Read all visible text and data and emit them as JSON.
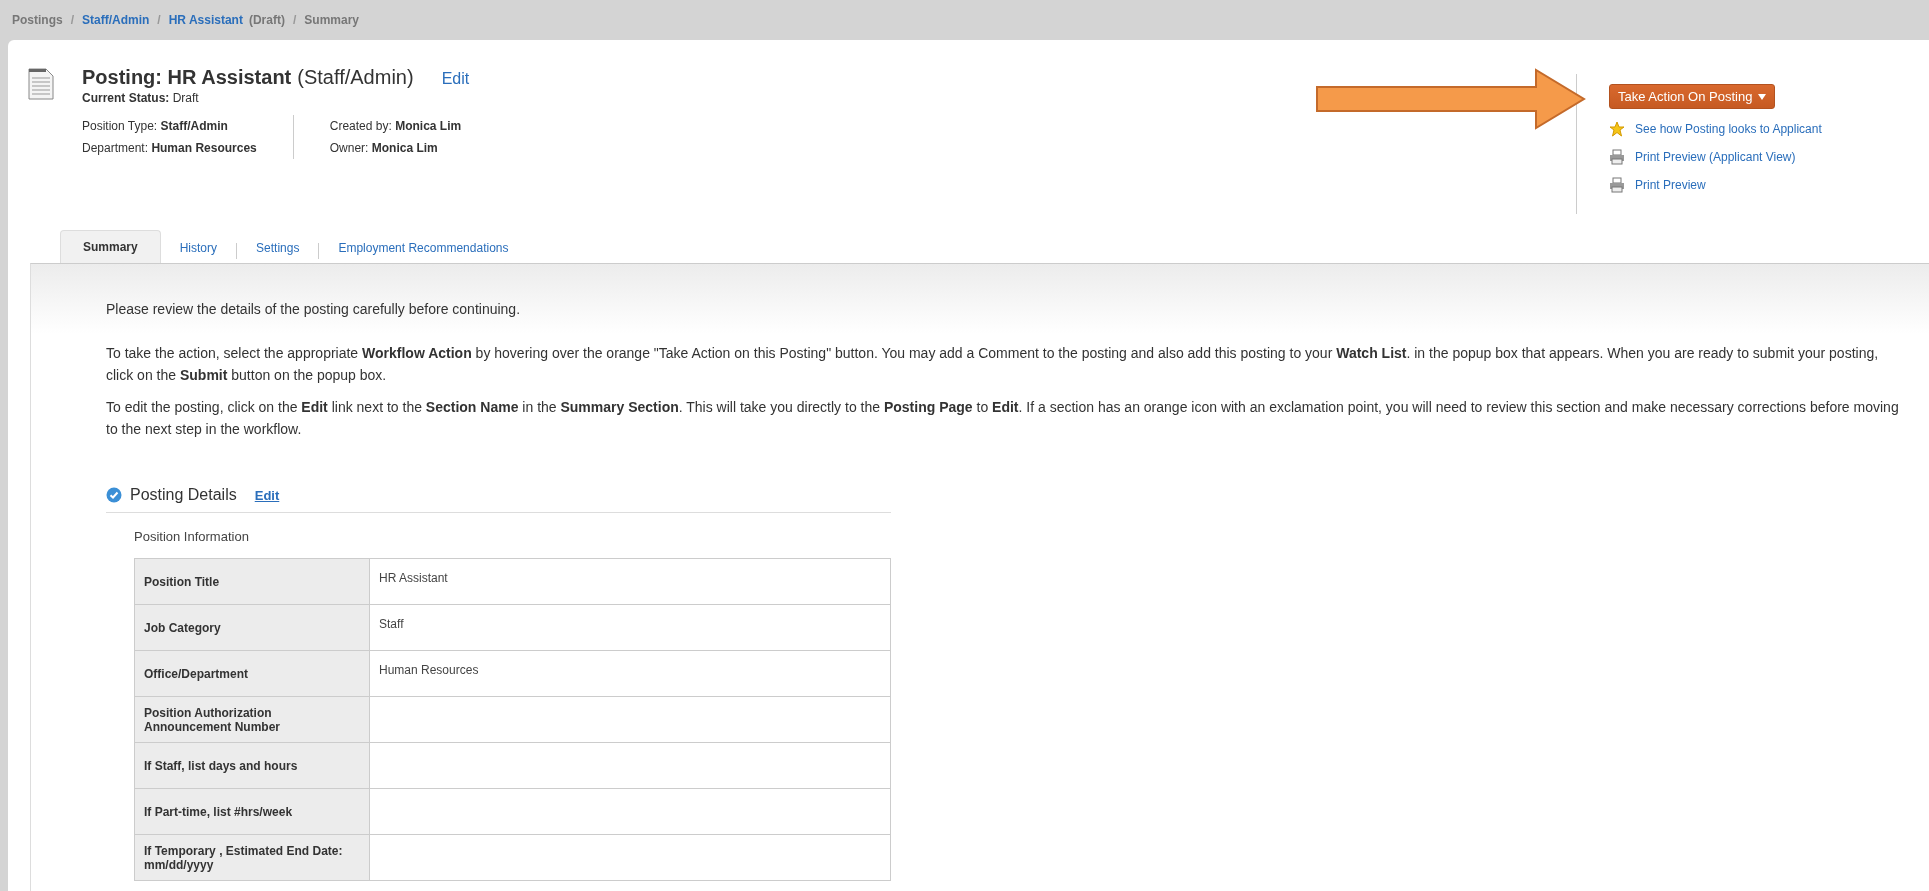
{
  "breadcrumb_separator": "/",
  "breadcrumb": [
    {
      "kind": "text",
      "label": "Postings"
    },
    {
      "kind": "link",
      "label": "Staff/Admin"
    },
    {
      "kind": "link",
      "label": "HR Assistant",
      "suffix": "(Draft)"
    },
    {
      "kind": "text",
      "label": "Summary"
    }
  ],
  "header": {
    "title": "Posting: HR Assistant",
    "title_suffix": "(Staff/Admin)",
    "edit_link": "Edit",
    "status_label": "Current Status:",
    "status": "Draft",
    "fields_left": [
      {
        "label": "Position Type:",
        "value": "Staff/Admin"
      },
      {
        "label": "Department:",
        "value": "Human Resources"
      }
    ],
    "fields_right": [
      {
        "label": "Created by:",
        "value": "Monica Lim"
      },
      {
        "label": "Owner:",
        "value": "Monica Lim"
      }
    ]
  },
  "actions": {
    "button": "Take Action On Posting",
    "links": [
      {
        "kind": "star",
        "label": "See how Posting looks to Applicant"
      },
      {
        "kind": "print",
        "label": "Print Preview (Applicant View)"
      },
      {
        "kind": "print",
        "label": "Print Preview"
      }
    ]
  },
  "tabs": [
    {
      "label": "Summary",
      "selected": true
    },
    {
      "label": "History",
      "selected": false
    },
    {
      "label": "Settings",
      "selected": false
    },
    {
      "label": "Employment Recommendations",
      "selected": false
    }
  ],
  "paragraphs": [
    "Please review the details of the posting carefully before continuing.",
    "To take the action, select the appropriate **Workflow Action** by hovering over the orange \"Take Action on this Posting\" button. You may add a Comment to the posting and also add this posting to your **Watch List**. in the popup box that appears. When you are ready to submit your posting, click on the **Submit** button on the popup box.",
    "To edit the posting, click on the **Edit** link next to the **Section Name** in the **Summary Section**. This will take you directly to the **Posting Page** to **Edit**. If a section has an orange icon with an exclamation point, you will need to review this section and make necessary corrections before moving to the next step in the workflow."
  ],
  "section": {
    "title": "Posting Details",
    "edit_link": "Edit",
    "subtitle": "Position Information",
    "rows": [
      {
        "label": "Position Title",
        "value": "HR Assistant"
      },
      {
        "label": "Job Category",
        "value": "Staff"
      },
      {
        "label": "Office/Department",
        "value": "Human Resources"
      },
      {
        "label": "Position Authorization Announcement Number"
      },
      {
        "label": "If Staff, list days and hours"
      },
      {
        "label": "If Part-time, list #hrs/week"
      },
      {
        "label": "If Temporary , Estimated End Date: mm/dd/yyyy"
      }
    ]
  }
}
